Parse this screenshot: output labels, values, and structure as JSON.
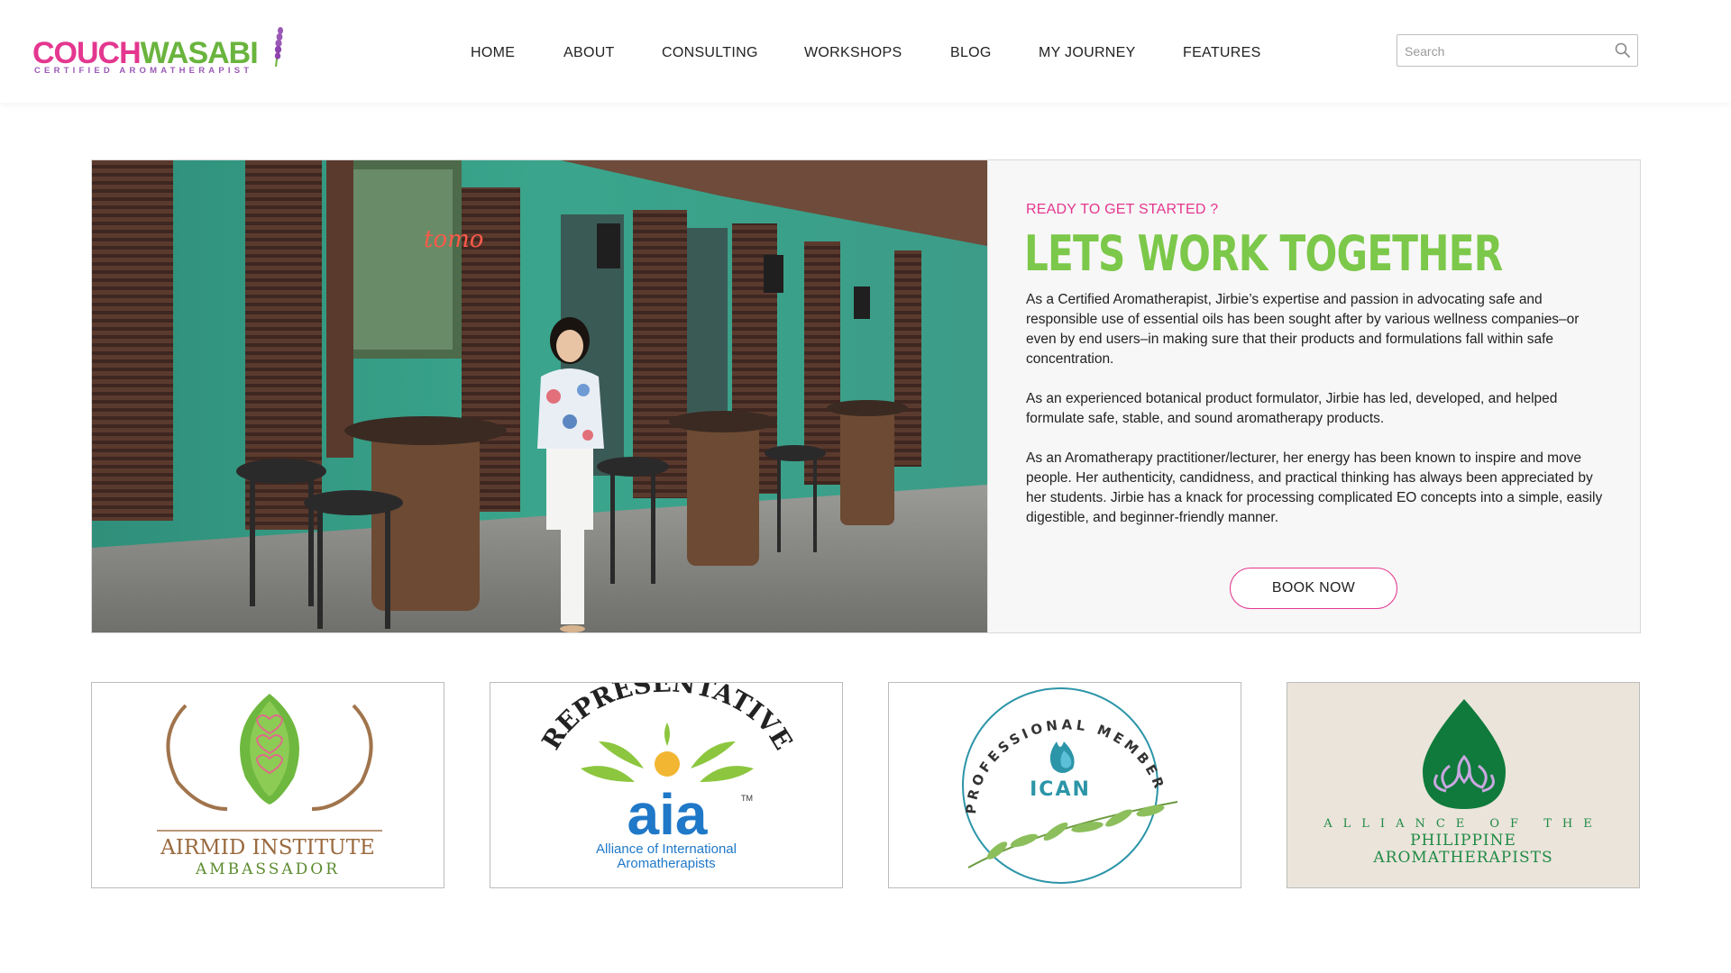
{
  "brand": {
    "name_part1": "COUCH",
    "name_part2": "WASABI",
    "tagline": "CERTIFIED AROMATHERAPIST",
    "colors": {
      "pink": "#e4378f",
      "green": "#6ab43e",
      "purple": "#9b59b6"
    }
  },
  "nav": {
    "items": [
      {
        "label": "HOME"
      },
      {
        "label": "ABOUT"
      },
      {
        "label": "CONSULTING"
      },
      {
        "label": "WORKSHOPS"
      },
      {
        "label": "BLOG"
      },
      {
        "label": "MY JOURNEY"
      },
      {
        "label": "FEATURES"
      }
    ]
  },
  "search": {
    "placeholder": "Search",
    "icon": "search-icon"
  },
  "hero": {
    "eyebrow": "READY TO GET STARTED ?",
    "headline": "LETS WORK TOGETHER",
    "paragraphs": [
      "As a Certified Aromatherapist, Jirbie’s expertise and passion in advocating safe and responsible use of essential oils has been sought after by various wellness companies–or even by end users–in making sure that their products and formulations fall within safe concentration.",
      "As an experienced botanical product formulator, Jirbie has led, developed, and helped formulate safe, stable, and sound aromatherapy products.",
      "As an Aromatherapy practitioner/lecturer, her energy has been known to inspire and move people. Her authenticity, candidness, and practical thinking has always been appreciated by her students. Jirbie has a knack for processing complicated EO concepts into a simple, easily digestible, and beginner-friendly manner."
    ],
    "cta": "BOOK NOW",
    "accent_color": "#7cc84a"
  },
  "badges": [
    {
      "line1": "AIRMID INSTITUTE",
      "line2": "AMBASSADOR"
    },
    {
      "arc": "REPRESENTATIVE",
      "mark": "aia",
      "tm": "TM",
      "line1": "Alliance of International",
      "line2": "Aromatherapists"
    },
    {
      "arc": "PROFESSIONAL MEMBER",
      "mark": "ICAN"
    },
    {
      "line1": "ALLIANCE OF THE",
      "line2": "PHILIPPINE",
      "line3": "AROMATHERAPISTS"
    }
  ]
}
